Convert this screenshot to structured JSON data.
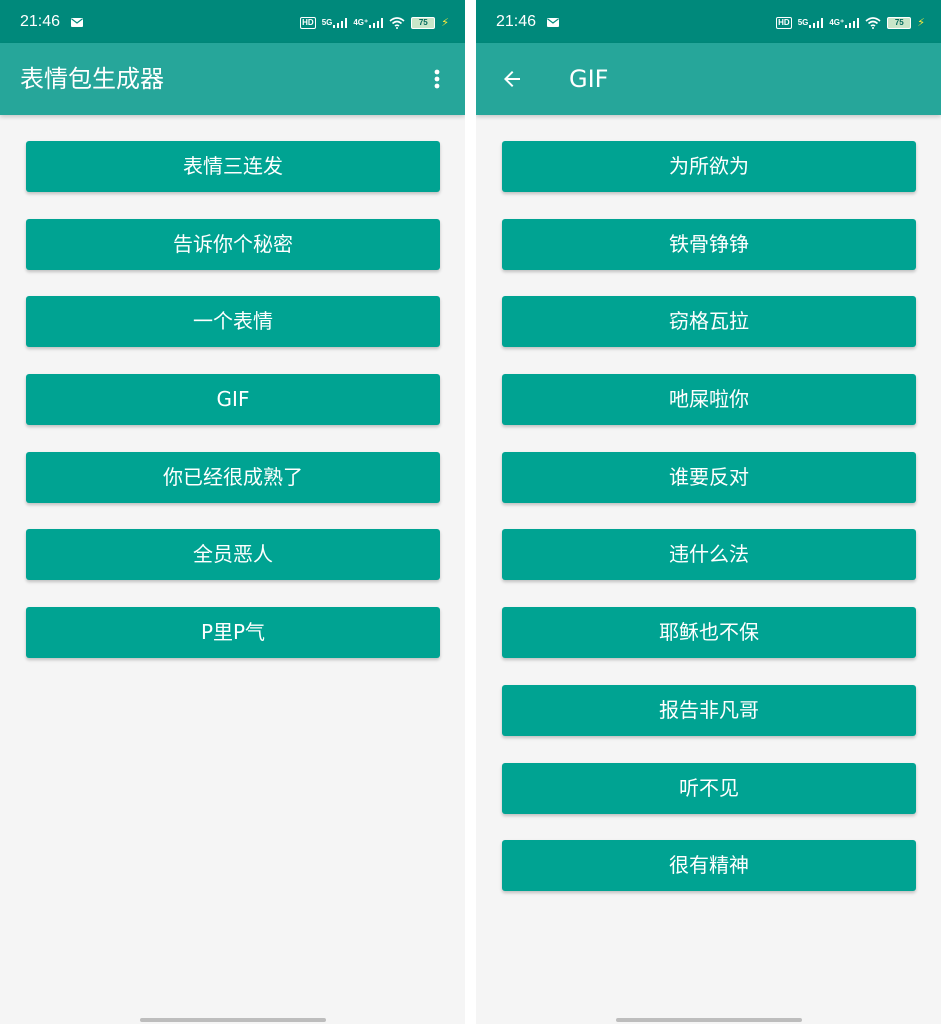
{
  "colors": {
    "statusbar": "#00897b",
    "appbar": "#26a69a",
    "button": "#00a392",
    "background": "#f5f5f5",
    "text_on_primary": "#ffffff"
  },
  "status_bar": {
    "time": "21:46",
    "hd_label": "HD",
    "net_5g": "5G",
    "net_4g": "4G⁺",
    "battery": "75",
    "icons": [
      "mail-icon",
      "signal-icon",
      "wifi-icon",
      "battery-icon",
      "charging-icon"
    ]
  },
  "screen_main": {
    "title": "表情包生成器",
    "menu_icon": "more-vertical-icon",
    "buttons": [
      "表情三连发",
      "告诉你个秘密",
      "一个表情",
      "GIF",
      "你已经很成熟了",
      "全员恶人",
      "P里P气"
    ]
  },
  "screen_gif": {
    "title": "GIF",
    "back_icon": "arrow-back-icon",
    "buttons": [
      "为所欲为",
      "铁骨铮铮",
      "窃格瓦拉",
      "吔屎啦你",
      "谁要反对",
      "违什么法",
      "耶稣也不保",
      "报告非凡哥",
      "听不见",
      "很有精神"
    ]
  }
}
